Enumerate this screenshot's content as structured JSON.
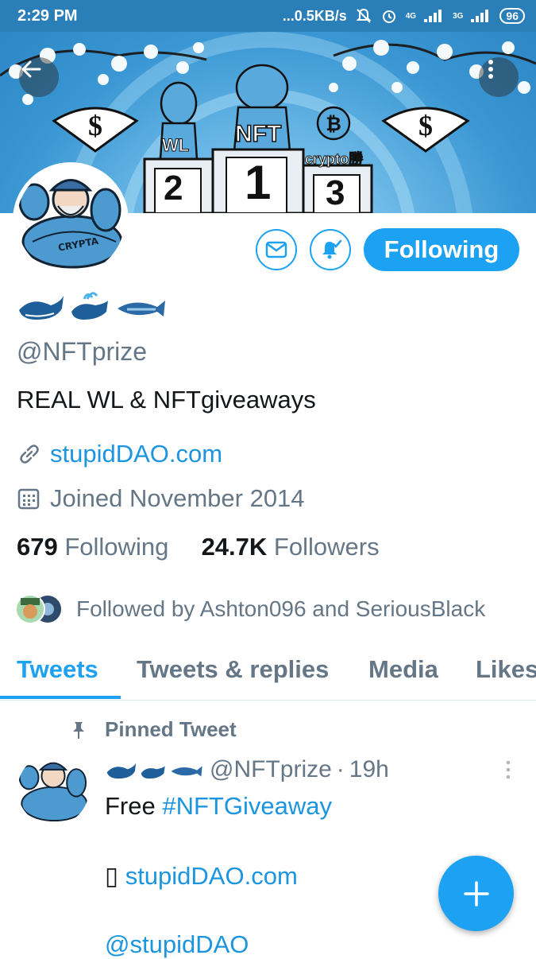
{
  "status_bar": {
    "time": "2:29 PM",
    "speed": "...0.5KB/s",
    "net1": "4G",
    "net2": "3G",
    "battery": "96",
    "icons": [
      "mute-icon",
      "alarm-icon",
      "signal-icon",
      "battery-icon"
    ]
  },
  "banner": {
    "podium_labels": [
      "2",
      "1",
      "3"
    ],
    "podium_titles": [
      "WL",
      "NFT",
      "crypto勝"
    ]
  },
  "profile": {
    "display_name_emoji": "🐋🐳🐟",
    "handle": "@NFTprize",
    "bio": "REAL WL & NFTgiveaways",
    "website": "stupidDAO.com",
    "joined": "Joined November 2014",
    "following_count": "679",
    "following_label": "Following",
    "followers_count": "24.7K",
    "followers_label": "Followers",
    "followed_by": "Followed by Ashton096 and SeriousBlack",
    "follow_button": "Following"
  },
  "tabs": [
    "Tweets",
    "Tweets & replies",
    "Media",
    "Likes"
  ],
  "pinned_tweet": {
    "label": "Pinned Tweet",
    "handle": "@NFTprize",
    "dot": "·",
    "time": "19h",
    "line1_text": "Free ",
    "line1_hashtag": "#NFTGiveaway",
    "line2_glyph": "▯",
    "line2_link": "stupidDAO.com",
    "line3_mention": "@stupidDAO"
  },
  "colors": {
    "accent": "#1da1f2",
    "link": "#1b95e0",
    "status_bar": "#2a7fb8",
    "secondary_text": "#657786"
  }
}
